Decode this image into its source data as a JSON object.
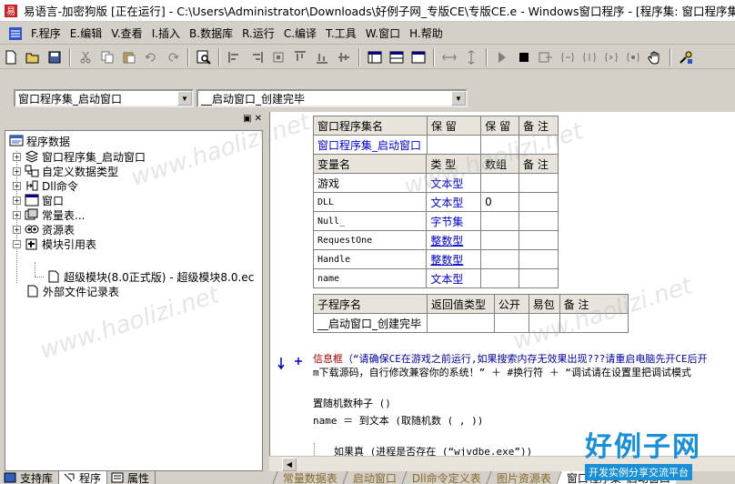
{
  "window": {
    "title": "易语言-加密狗版 [正在运行] - C:\\Users\\Administrator\\Downloads\\好例子网_专版CE\\专版CE.e - Windows窗口程序 - [程序集: 窗口程序集_启动窗"
  },
  "menu": {
    "items": [
      "F.程序",
      "E.编辑",
      "V.查看",
      "I.插入",
      "B.数据库",
      "R.运行",
      "C.编译",
      "T.工具",
      "W.窗口",
      "H.帮助"
    ]
  },
  "combos": {
    "left": "窗口程序集_启动窗口",
    "right": "__启动窗口_创建完毕"
  },
  "tree": {
    "root": "程序数据",
    "items": [
      {
        "label": "窗口程序集_启动窗口",
        "icon": "stack-icon"
      },
      {
        "label": "自定义数据类型",
        "icon": "datatype-icon"
      },
      {
        "label": "Dll命令",
        "icon": "dll-icon"
      },
      {
        "label": "窗口",
        "icon": "window-icon"
      },
      {
        "label": "常量表...",
        "icon": "constant-icon"
      },
      {
        "label": "资源表",
        "icon": "resource-icon"
      },
      {
        "label": "模块引用表",
        "icon": "module-icon"
      },
      {
        "label": "超级模块(8.0正式版) - 超级模块8.0.ec",
        "icon": "file-icon"
      },
      {
        "label": "外部文件记录表",
        "icon": "file-icon"
      }
    ]
  },
  "left_tabs": [
    "支持库",
    "程序",
    "属性"
  ],
  "assembly_table": {
    "headers": [
      "窗口程序集名",
      "保 留",
      "保 留",
      "备 注"
    ],
    "row": [
      "窗口程序集_启动窗口",
      "",
      "",
      ""
    ]
  },
  "variable_table": {
    "headers": [
      "变量名",
      "类 型",
      "数组",
      "备 注"
    ],
    "rows": [
      [
        "游戏",
        "文本型",
        "",
        ""
      ],
      [
        "DLL",
        "文本型",
        "0",
        ""
      ],
      [
        "Null_",
        "字节集",
        "",
        ""
      ],
      [
        "RequestOne",
        "整数型",
        "",
        ""
      ],
      [
        "Handle",
        "整数型",
        "",
        ""
      ],
      [
        "name",
        "文本型",
        "",
        ""
      ]
    ]
  },
  "sub_table": {
    "headers": [
      "子程序名",
      "返回值类型",
      "公开",
      "易包",
      "备 注"
    ],
    "row": [
      "__启动窗口_创建完毕",
      "",
      "",
      "",
      ""
    ]
  },
  "code": {
    "line1_cmd": "信息框",
    "line1_str": "（“请确保CE在游戏之前运行,如果搜索内存无效果出现???请重启电脑先开CE后开",
    "line2": "m下载源码，自行修改兼容你的系统！” ＋ #换行符 ＋ “调试请在设置里把调试模式",
    "line3": "置随机数种子 ()",
    "line4": "name ＝ 到文本 (取随机数 ( , ))",
    "line5": "如果真 (进程是否存在 (“wjvdbe.exe”))"
  },
  "right_tabs": [
    "常量数据表",
    "启动窗口",
    "Dll命令定义表",
    "图片资源表",
    "窗口程序集_启动窗口"
  ],
  "watermark": {
    "text": "www.haolizi.net",
    "logo_big": "好例子网",
    "logo_small": "开发实例分享交流平台"
  },
  "colors": {
    "chrome": "#d4d0c8",
    "type_blue": "#0000c8",
    "command_red": "#a00000",
    "watermark_blue": "#1a8fd6"
  }
}
